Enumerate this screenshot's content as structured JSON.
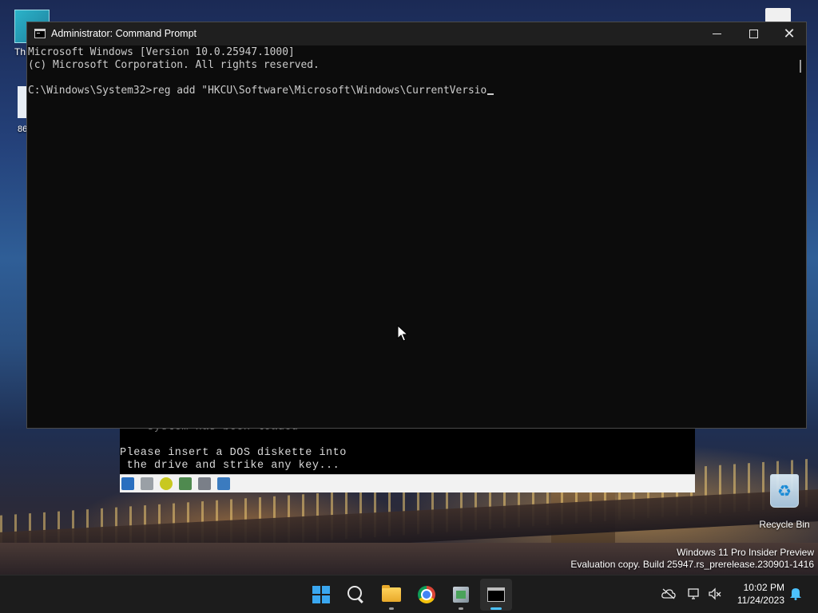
{
  "desktop": {
    "icon_label_1": "Th",
    "icon_label_2": "86",
    "recycle_bin_label": "Recycle Bin",
    "watermark_line1": "Windows 11 Pro Insider Preview",
    "watermark_line2": "Evaluation copy. Build 25947.rs_prerelease.230901-1416"
  },
  "dos_window": {
    "line_partial": "    system has been loaded",
    "line1": "Please insert a DOS diskette into",
    "line2": " the drive and strike any key...",
    "toolbar_icons": [
      "floppy-icon",
      "grid-icon",
      "cd-icon",
      "network-icon",
      "display-icon",
      "sound-icon"
    ]
  },
  "cmd": {
    "title": "Administrator: Command Prompt",
    "lines": [
      "Microsoft Windows [Version 10.0.25947.1000]",
      "(c) Microsoft Corporation. All rights reserved.",
      "",
      "C:\\Windows\\System32>reg add \"HKCU\\Software\\Microsoft\\Windows\\CurrentVersio"
    ]
  },
  "taskbar": {
    "apps": [
      "start-button",
      "search-button",
      "file-explorer",
      "chrome",
      "setup-app",
      "terminal"
    ],
    "active_app": "terminal",
    "time": "10:02 PM",
    "date": "11/24/2023"
  },
  "colors": {
    "terminal_bg": "#0c0c0c",
    "terminal_fg": "#cccccc",
    "titlebar": "#1f1f1f",
    "taskbar": "#1c1c1c",
    "accent": "#4cc2ff"
  }
}
